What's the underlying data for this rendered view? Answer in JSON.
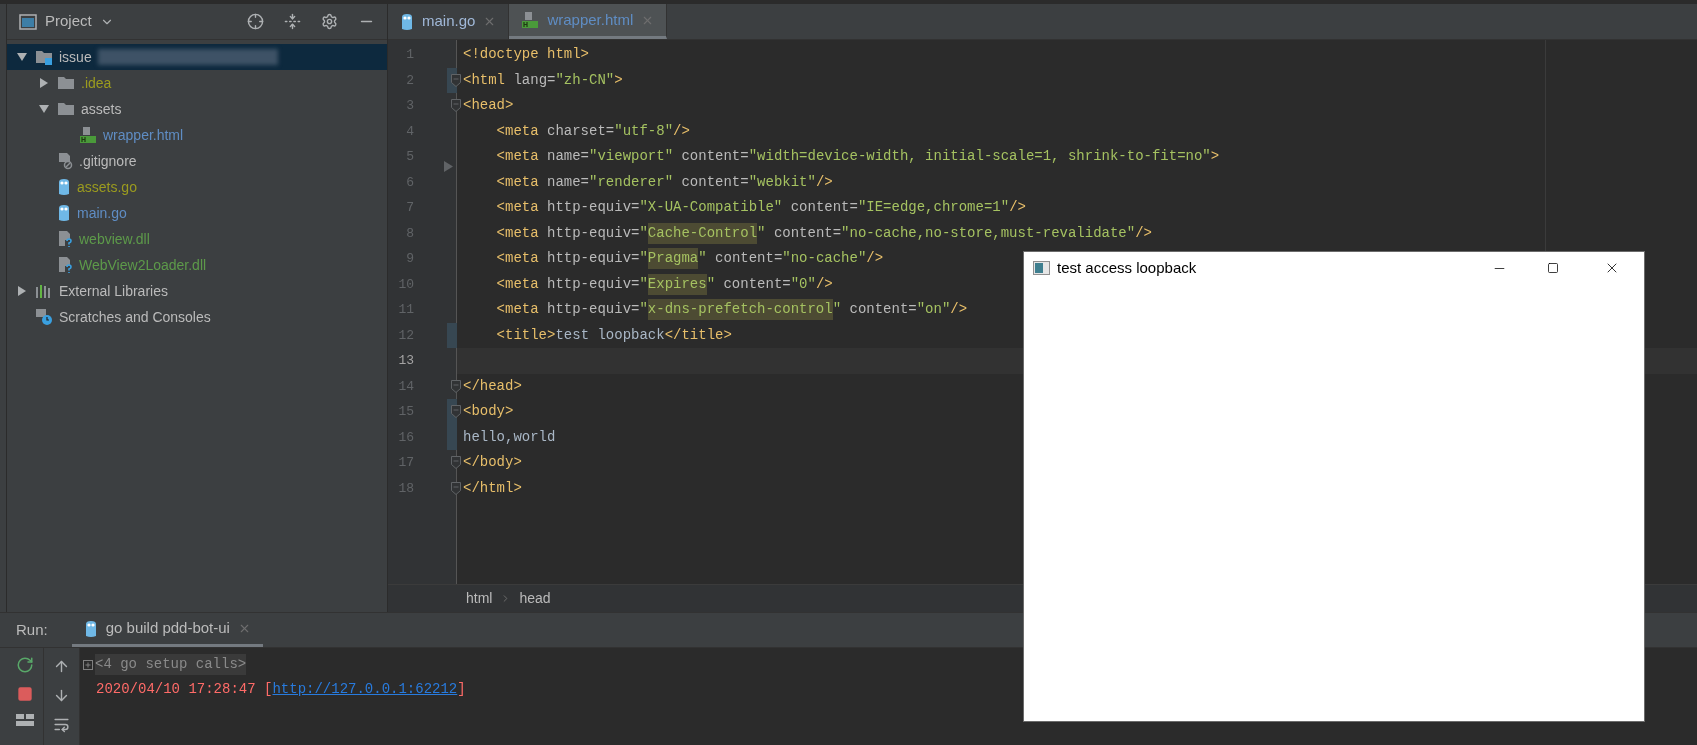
{
  "project_panel": {
    "title": "Project",
    "tree": [
      {
        "label": "issue",
        "kind": "project",
        "color": "#bbbbbb",
        "selected": true,
        "expanded": true,
        "children": [
          {
            "label": ".idea",
            "kind": "folder",
            "color": "#9b9b1f",
            "selected": false,
            "expanded": false
          },
          {
            "label": "assets",
            "kind": "folder",
            "color": "#bbbbbb",
            "selected": false,
            "expanded": true,
            "children": [
              {
                "label": "wrapper.html",
                "kind": "html",
                "color": "#5f8dc4",
                "selected": false
              }
            ]
          },
          {
            "label": ".gitignore",
            "kind": "ignore",
            "color": "#bbbbbb",
            "selected": false
          },
          {
            "label": "assets.go",
            "kind": "gopher",
            "color": "#9b9b1f",
            "selected": false
          },
          {
            "label": "main.go",
            "kind": "gopher",
            "color": "#5f8dc4",
            "selected": false
          },
          {
            "label": "webview.dll",
            "kind": "unknown",
            "color": "#5d9a4a",
            "selected": false
          },
          {
            "label": "WebView2Loader.dll",
            "kind": "unknown",
            "color": "#5d9a4a",
            "selected": false
          }
        ]
      },
      {
        "label": "External Libraries",
        "kind": "library",
        "color": "#bbbbbb",
        "selected": false,
        "expanded": false
      },
      {
        "label": "Scratches and Consoles",
        "kind": "scratches",
        "color": "#bbbbbb",
        "selected": false
      }
    ]
  },
  "editor_tabs": [
    {
      "label": "main.go",
      "kind": "gopher",
      "selected": false
    },
    {
      "label": "wrapper.html",
      "kind": "html",
      "selected": true
    }
  ],
  "code_lines": [
    {
      "number": "1",
      "fold": false,
      "changed": false,
      "current": false,
      "segments": [
        {
          "kind": "tag",
          "text": "<!doctype html>"
        }
      ]
    },
    {
      "number": "2",
      "fold": true,
      "changed": true,
      "current": false,
      "segments": [
        {
          "kind": "tag",
          "text": "<html "
        },
        {
          "kind": "attr",
          "text": "lang="
        },
        {
          "kind": "value",
          "text": "\"zh-CN\""
        },
        {
          "kind": "tag",
          "text": ">"
        }
      ]
    },
    {
      "number": "3",
      "fold": true,
      "changed": false,
      "current": false,
      "segments": [
        {
          "kind": "tag",
          "text": "<head>"
        }
      ]
    },
    {
      "number": "4",
      "fold": false,
      "changed": false,
      "current": false,
      "segments": [
        {
          "kind": "tag",
          "text": "    <meta "
        },
        {
          "kind": "attr",
          "text": "charset="
        },
        {
          "kind": "value",
          "text": "\"utf-8\""
        },
        {
          "kind": "tag",
          "text": "/>"
        }
      ]
    },
    {
      "number": "5",
      "fold": false,
      "changed": false,
      "current": false,
      "segments": [
        {
          "kind": "tag",
          "text": "    <meta "
        },
        {
          "kind": "attr",
          "text": "name="
        },
        {
          "kind": "value",
          "text": "\"viewport\" "
        },
        {
          "kind": "attr",
          "text": "content="
        },
        {
          "kind": "value",
          "text": "\"width=device-width, initial-scale=1, shrink-to-fit=no\""
        },
        {
          "kind": "tag",
          "text": ">"
        }
      ]
    },
    {
      "number": "6",
      "fold": false,
      "changed": false,
      "current": false,
      "segments": [
        {
          "kind": "tag",
          "text": "    <meta "
        },
        {
          "kind": "attr",
          "text": "name="
        },
        {
          "kind": "value",
          "text": "\"renderer\" "
        },
        {
          "kind": "attr",
          "text": "content="
        },
        {
          "kind": "value",
          "text": "\"webkit\""
        },
        {
          "kind": "tag",
          "text": "/>"
        }
      ]
    },
    {
      "number": "7",
      "fold": false,
      "changed": false,
      "current": false,
      "segments": [
        {
          "kind": "tag",
          "text": "    <meta "
        },
        {
          "kind": "attr",
          "text": "http-equiv="
        },
        {
          "kind": "value",
          "text": "\"X-UA-Compatible\" "
        },
        {
          "kind": "attr",
          "text": "content="
        },
        {
          "kind": "value",
          "text": "\"IE=edge,chrome=1\""
        },
        {
          "kind": "tag",
          "text": "/>"
        }
      ]
    },
    {
      "number": "8",
      "fold": false,
      "changed": false,
      "current": false,
      "segments": [
        {
          "kind": "tag",
          "text": "    <meta "
        },
        {
          "kind": "attr",
          "text": "http-equiv="
        },
        {
          "kind": "value",
          "text": "\""
        },
        {
          "kind": "marked",
          "text": "Cache-Control"
        },
        {
          "kind": "value",
          "text": "\" "
        },
        {
          "kind": "attr",
          "text": "content="
        },
        {
          "kind": "value",
          "text": "\"no-cache,no-store,must-revalidate\""
        },
        {
          "kind": "tag",
          "text": "/>"
        }
      ]
    },
    {
      "number": "9",
      "fold": false,
      "changed": false,
      "current": false,
      "segments": [
        {
          "kind": "tag",
          "text": "    <meta "
        },
        {
          "kind": "attr",
          "text": "http-equiv="
        },
        {
          "kind": "value",
          "text": "\""
        },
        {
          "kind": "marked",
          "text": "Pragma"
        },
        {
          "kind": "value",
          "text": "\" "
        },
        {
          "kind": "attr",
          "text": "content="
        },
        {
          "kind": "value",
          "text": "\"no-cache\""
        },
        {
          "kind": "tag",
          "text": "/>"
        }
      ]
    },
    {
      "number": "10",
      "fold": false,
      "changed": false,
      "current": false,
      "segments": [
        {
          "kind": "tag",
          "text": "    <meta "
        },
        {
          "kind": "attr",
          "text": "http-equiv="
        },
        {
          "kind": "value",
          "text": "\""
        },
        {
          "kind": "marked",
          "text": "Expires"
        },
        {
          "kind": "value",
          "text": "\" "
        },
        {
          "kind": "attr",
          "text": "content="
        },
        {
          "kind": "value",
          "text": "\"0\""
        },
        {
          "kind": "tag",
          "text": "/>"
        }
      ]
    },
    {
      "number": "11",
      "fold": false,
      "changed": false,
      "current": false,
      "segments": [
        {
          "kind": "tag",
          "text": "    <meta "
        },
        {
          "kind": "attr",
          "text": "http-equiv="
        },
        {
          "kind": "value",
          "text": "\""
        },
        {
          "kind": "marked",
          "text": "x-dns-prefetch-control"
        },
        {
          "kind": "value",
          "text": "\" "
        },
        {
          "kind": "attr",
          "text": "content="
        },
        {
          "kind": "value",
          "text": "\"on\""
        },
        {
          "kind": "tag",
          "text": "/>"
        }
      ]
    },
    {
      "number": "12",
      "fold": false,
      "changed": true,
      "current": false,
      "segments": [
        {
          "kind": "tag",
          "text": "    <title>"
        },
        {
          "kind": "text",
          "text": "test loopback"
        },
        {
          "kind": "tag",
          "text": "</title>"
        }
      ]
    },
    {
      "number": "13",
      "fold": false,
      "changed": false,
      "current": true
    },
    {
      "number": "14",
      "fold": true,
      "changed": false,
      "current": false,
      "segments": [
        {
          "kind": "tag",
          "text": "</head>"
        }
      ]
    },
    {
      "number": "15",
      "fold": true,
      "changed": true,
      "current": false,
      "segments": [
        {
          "kind": "tag",
          "text": "<body>"
        }
      ]
    },
    {
      "number": "16",
      "fold": false,
      "changed": true,
      "current": false,
      "segments": [
        {
          "kind": "text",
          "text": "hello,world"
        }
      ]
    },
    {
      "number": "17",
      "fold": true,
      "changed": false,
      "current": false,
      "segments": [
        {
          "kind": "tag",
          "text": "</body>"
        }
      ]
    },
    {
      "number": "18",
      "fold": true,
      "changed": false,
      "current": false,
      "segments": [
        {
          "kind": "tag",
          "text": "</html>"
        }
      ]
    }
  ],
  "breadcrumbs": [
    "html",
    "head"
  ],
  "run_panel": {
    "label": "Run:",
    "tab": "go build pdd-bot-ui",
    "output": [
      {
        "kind": "collapsed",
        "text": "<4 go setup calls>"
      },
      {
        "kind": "log",
        "text": "2020/04/10 17:28:47 [",
        "link": "http://127.0.0.1:62212",
        "after": "]"
      }
    ]
  },
  "popup_window": {
    "title": "test access loopback"
  }
}
